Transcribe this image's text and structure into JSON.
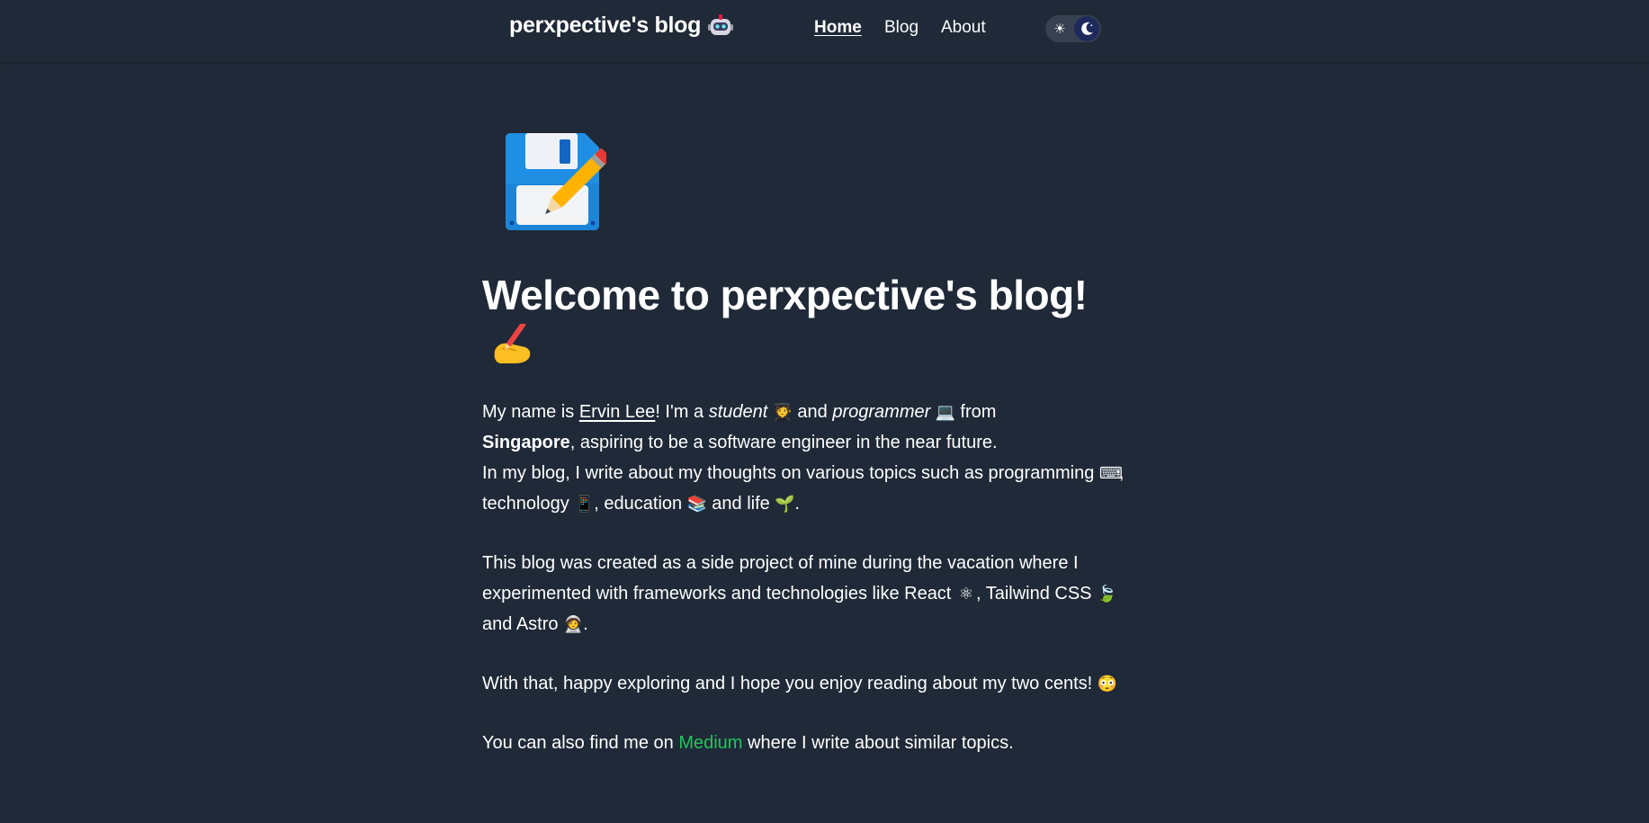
{
  "header": {
    "brand": "perxpective's blog",
    "nav": [
      {
        "label": "Home",
        "active": true
      },
      {
        "label": "Blog",
        "active": false
      },
      {
        "label": "About",
        "active": false
      }
    ],
    "theme_toggle": {
      "sun_icon": "sun-icon",
      "moon_icon": "moon-icon",
      "selected": "dark"
    }
  },
  "main": {
    "hero_icon": "floppy-disk-pencil-icon",
    "title": "Welcome to perxpective's blog!",
    "title_icon": "writing-hand-icon",
    "p1": {
      "t1": "My name is ",
      "name_link": "Ervin Lee",
      "t2": "! I'm a ",
      "student": "student",
      "e_student": "🧑‍🎓",
      "t3": " and ",
      "programmer": "programmer",
      "e_laptop": "💻",
      "t4": " from",
      "singapore": "Singapore",
      "t5": ", aspiring to be a software engineer in the near future."
    },
    "p1b": {
      "t1": "In my blog, I write about my thoughts on various topics such as programming ",
      "e_keyboard": "⌨",
      "t2": ", technology ",
      "e_phone": "📱",
      "t3": ", education ",
      "e_books": "📚",
      "t4": " and life ",
      "e_seedling": "🌱",
      "t5": "."
    },
    "p2": {
      "t1": "This blog was created as a side project of mine during the vacation where I experimented with frameworks and technologies like React ",
      "e_atom": "⚛",
      "t2": ", Tailwind CSS ",
      "e_leaves": "🍃",
      "t3": " and Astro ",
      "e_astronaut": "🧑‍🚀",
      "t4": "."
    },
    "p3": {
      "t1": "With that, happy exploring and I hope you enjoy reading about my two cents! ",
      "e_face": "😳"
    },
    "p4": {
      "t1": "You can also find me on ",
      "medium_link": "Medium",
      "t2": " where I write about similar topics."
    }
  },
  "colors": {
    "background": "#1f2937",
    "text": "#ffffff",
    "link_accent": "#22c55e",
    "toggle_track": "#374151",
    "toggle_knob": "#1e2a5c"
  }
}
